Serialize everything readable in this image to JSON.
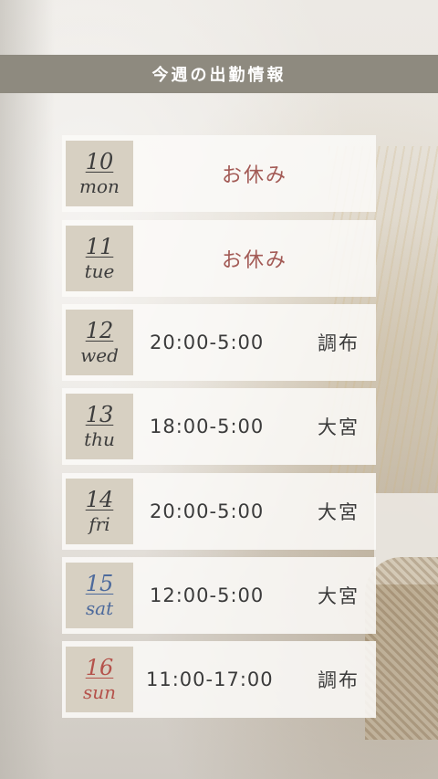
{
  "header": {
    "title": "今週の出勤情報"
  },
  "schedule": [
    {
      "num": "10",
      "day": "mon",
      "num_color": "#3d3d3d",
      "off_label": "お休み"
    },
    {
      "num": "11",
      "day": "tue",
      "num_color": "#3d3d3d",
      "off_label": "お休み"
    },
    {
      "num": "12",
      "day": "wed",
      "num_color": "#3d3d3d",
      "time": "20:00-5:00",
      "place": "調布"
    },
    {
      "num": "13",
      "day": "thu",
      "num_color": "#3d3d3d",
      "time": "18:00-5:00",
      "place": "大宮"
    },
    {
      "num": "14",
      "day": "fri",
      "num_color": "#3d3d3d",
      "time": "20:00-5:00",
      "place": "大宮"
    },
    {
      "num": "15",
      "day": "sat",
      "num_color": "#4d6a9c",
      "time": "12:00-5:00",
      "place": "大宮"
    },
    {
      "num": "16",
      "day": "sun",
      "num_color": "#b5524b",
      "time": "11:00-17:00",
      "place": "調布"
    }
  ],
  "colors": {
    "header_bg": "#8e8a7f",
    "badge_bg": "#d7d0c2",
    "off_text": "#a35a55"
  }
}
